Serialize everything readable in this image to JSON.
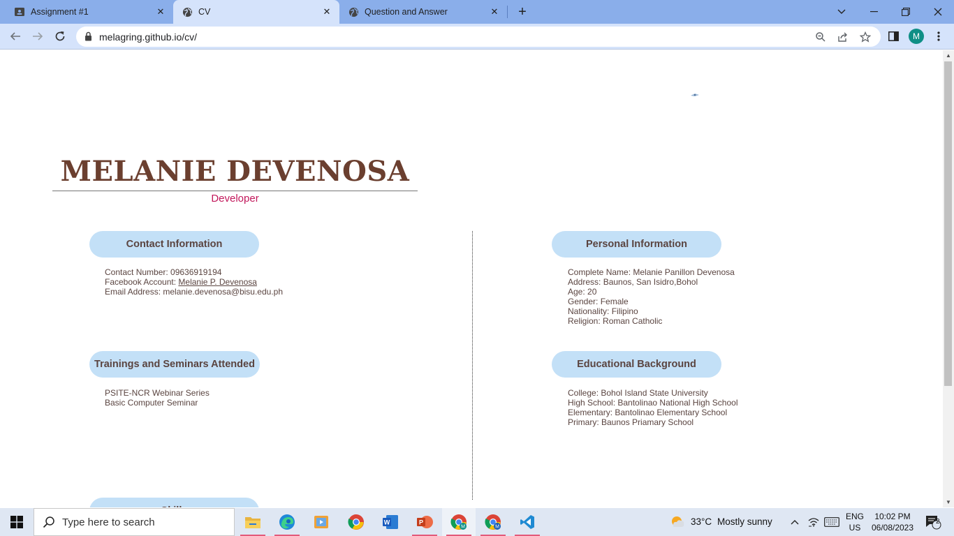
{
  "browser": {
    "tabs": [
      {
        "title": "Assignment #1",
        "icon": "classroom-icon"
      },
      {
        "title": "CV",
        "icon": "globe-icon"
      },
      {
        "title": "Question and Answer",
        "icon": "globe-icon"
      }
    ],
    "url": "melagring.github.io/cv/",
    "profile_initial": "M",
    "accent": "#8aaeea"
  },
  "cv": {
    "name": "MELANIE DEVENOSA",
    "role": "Developer",
    "sections": {
      "contact": {
        "title": "Contact Information",
        "number_label": "Contact Number: 09636919194",
        "facebook_label": "Facebook Account: ",
        "facebook_link": "Melanie P. Devenosa",
        "email_label": "Email Address: melanie.devenosa@bisu.edu.ph"
      },
      "personal": {
        "title": "Personal Information",
        "lines": [
          "Complete Name: Melanie Panillon Devenosa",
          "Address: Baunos, San Isidro,Bohol",
          "Age: 20",
          "Gender: Female",
          "Nationality: Filipino",
          "Religion: Roman Catholic"
        ]
      },
      "trainings": {
        "title": "Trainings and Seminars Attended",
        "lines": [
          "PSITE-NCR Webinar Series",
          "Basic Computer Seminar"
        ]
      },
      "education": {
        "title": "Educational Background",
        "lines": [
          "College: Bohol Island State University",
          "High School: Bantolinao National High School",
          "Elementary: Bantolinao Elementary School",
          "Primary: Baunos Priamary School"
        ]
      },
      "skills": {
        "title": "Skills"
      }
    },
    "colors": {
      "name": "#6b3f2f",
      "role": "#c2185b",
      "pill": "#c3e0f7"
    }
  },
  "taskbar": {
    "search_placeholder": "Type here to search",
    "weather_temp": "33°C",
    "weather_text": "Mostly sunny",
    "lang_top": "ENG",
    "lang_bottom": "US",
    "time": "10:02 PM",
    "date": "06/08/2023",
    "notification_count": "2"
  }
}
